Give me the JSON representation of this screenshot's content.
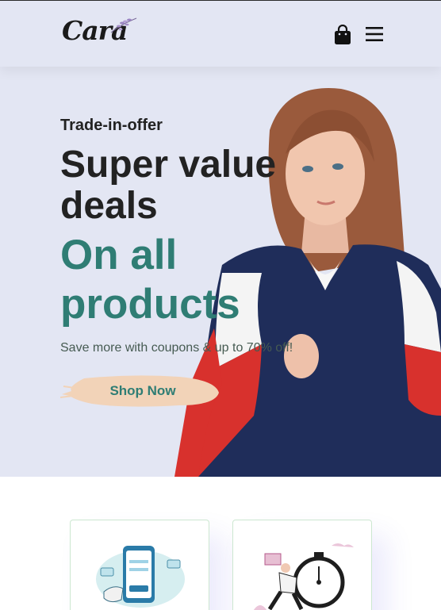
{
  "header": {
    "logo_text": "Cara",
    "icons": [
      "shopping-bag-icon",
      "hamburger-menu-icon"
    ]
  },
  "hero": {
    "eyebrow": "Trade-in-offer",
    "headline": "Super value deals",
    "sub_headline": "On all products",
    "tagline": "Save more with coupons & up to 70% off!",
    "cta_label": "Shop Now"
  },
  "colors": {
    "header_bg": "#e3e6f3",
    "accent": "#2f7d74",
    "text_dark": "#222222",
    "button_brush": "#f2d3b8"
  },
  "features": {
    "cards": [
      {
        "icon": "payment-phone-illustration"
      },
      {
        "icon": "fast-delivery-stopwatch-illustration"
      }
    ]
  }
}
